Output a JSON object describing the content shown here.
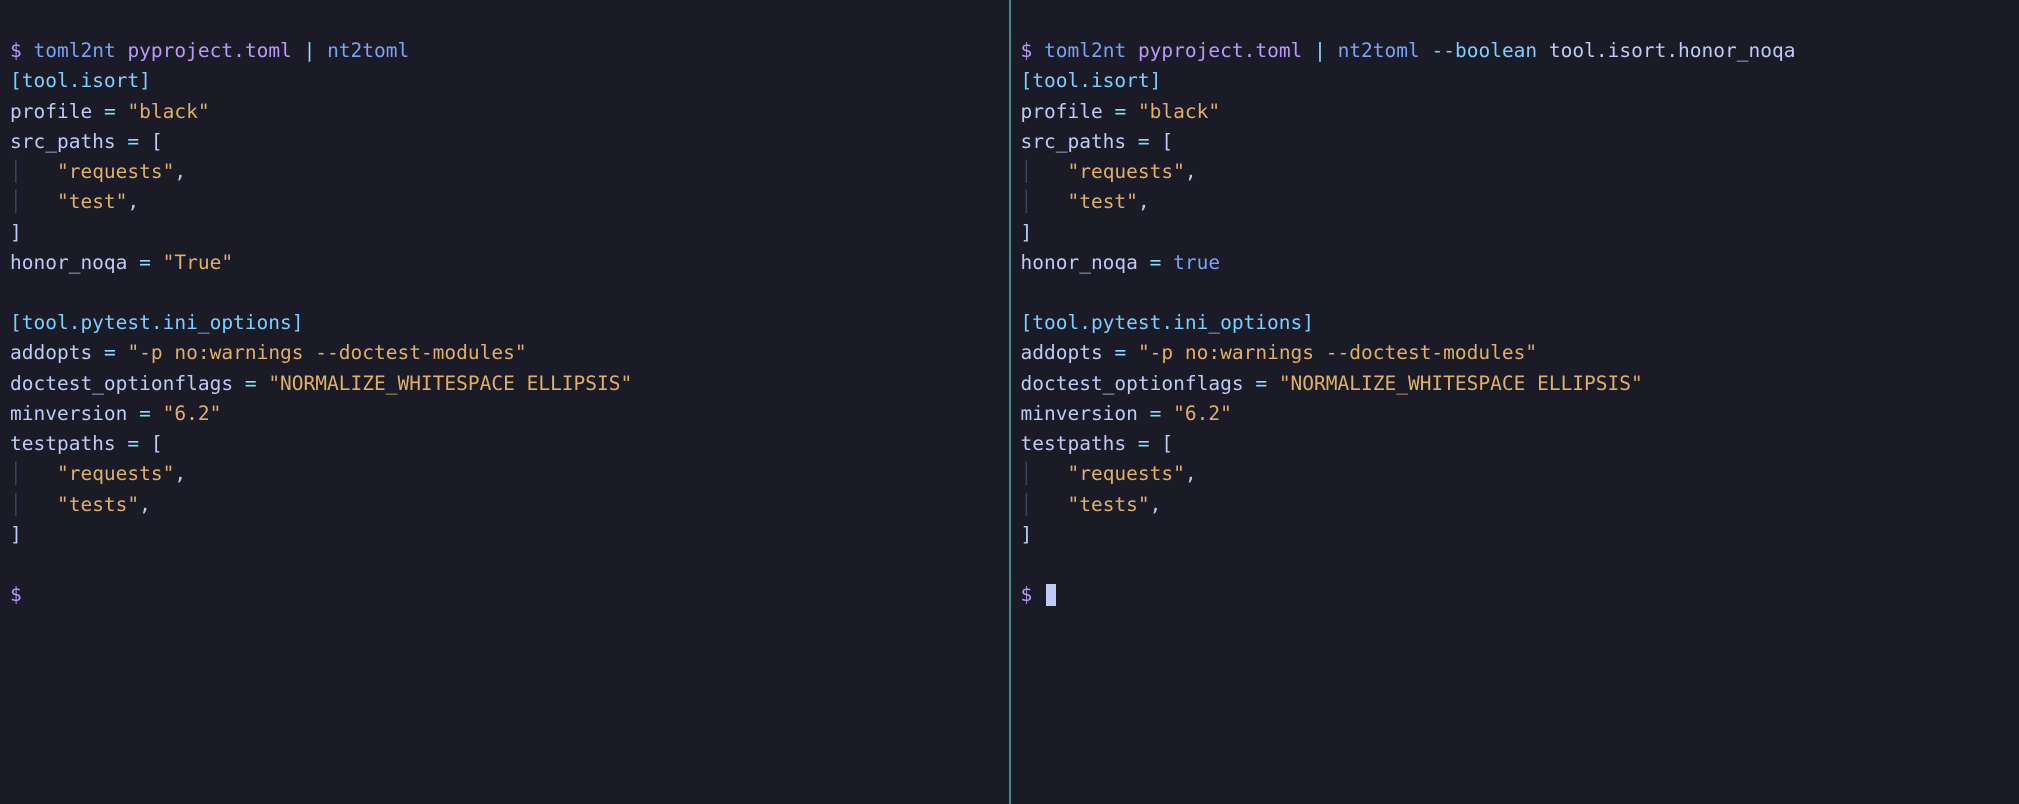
{
  "left": {
    "prompt": "$",
    "cmd1": "toml2nt",
    "arg": "pyproject.toml",
    "pipe": "|",
    "cmd2": "nt2toml",
    "section1": "[tool.isort]",
    "k_profile": "profile",
    "v_profile": "\"black\"",
    "k_src_paths": "src_paths",
    "bracket_open": "[",
    "src1": "\"requests\"",
    "src2": "\"test\"",
    "bracket_close": "]",
    "k_honor": "honor_noqa",
    "v_honor": "\"True\"",
    "section2": "[tool.pytest.ini_options]",
    "k_addopts": "addopts",
    "v_addopts": "\"-p no:warnings --doctest-modules\"",
    "k_doctest": "doctest_optionflags",
    "v_doctest": "\"NORMALIZE_WHITESPACE ELLIPSIS\"",
    "k_minver": "minversion",
    "v_minver": "\"6.2\"",
    "k_testpaths": "testpaths",
    "tp1": "\"requests\"",
    "tp2": "\"tests\"",
    "eq": "=",
    "comma": ",",
    "guide": "│   "
  },
  "right": {
    "prompt": "$",
    "cmd1": "toml2nt",
    "arg": "pyproject.toml",
    "pipe": "|",
    "cmd2": "nt2toml",
    "flag": "--boolean",
    "flagval": "tool.isort.honor_noqa",
    "section1": "[tool.isort]",
    "k_profile": "profile",
    "v_profile": "\"black\"",
    "k_src_paths": "src_paths",
    "bracket_open": "[",
    "src1": "\"requests\"",
    "src2": "\"test\"",
    "bracket_close": "]",
    "k_honor": "honor_noqa",
    "v_honor": "true",
    "section2": "[tool.pytest.ini_options]",
    "k_addopts": "addopts",
    "v_addopts": "\"-p no:warnings --doctest-modules\"",
    "k_doctest": "doctest_optionflags",
    "v_doctest": "\"NORMALIZE_WHITESPACE ELLIPSIS\"",
    "k_minver": "minversion",
    "v_minver": "\"6.2\"",
    "k_testpaths": "testpaths",
    "tp1": "\"requests\"",
    "tp2": "\"tests\"",
    "eq": "=",
    "comma": ",",
    "guide": "│   "
  }
}
